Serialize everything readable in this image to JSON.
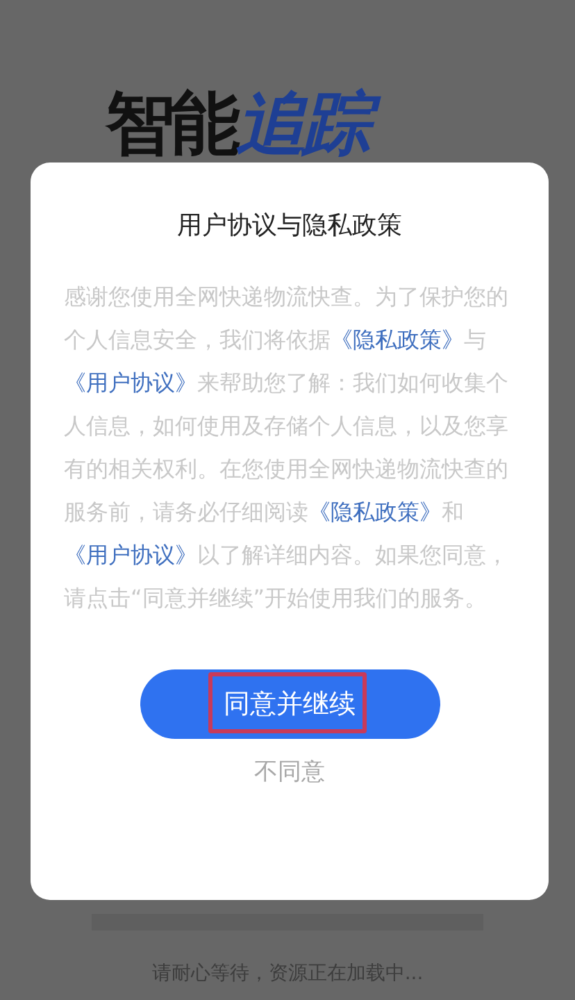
{
  "logo": [
    {
      "text": "智能",
      "color": "#111111"
    },
    {
      "text": "追踪",
      "color": "#1e3f94"
    }
  ],
  "dialog": {
    "title": "用户协议与隐私政策",
    "body": [
      {
        "kind": "text",
        "text": "感谢您使用全网快递物流快查。为了保护您的个人信息安全，我们将依据"
      },
      {
        "kind": "link",
        "text": "《隐私政策》"
      },
      {
        "kind": "text",
        "text": "与"
      },
      {
        "kind": "link",
        "text": "《用户协议》"
      },
      {
        "kind": "text",
        "text": "来帮助您了解：我们如何收集个人信息，如何使用及存储个人信息，以及您享有的相关权利。在您使用全网快递物流快查的服务前，请务必仔细阅读"
      },
      {
        "kind": "link",
        "text": "《隐私政策》"
      },
      {
        "kind": "text",
        "text": "和"
      },
      {
        "kind": "link",
        "text": "《用户协议》"
      },
      {
        "kind": "text",
        "text": "以了解详细内容。如果您同意，请点击“同意并继续”开始使用我们的服务。"
      }
    ],
    "agree_button": {
      "label": "同意并继续",
      "highlighted": true
    },
    "decline_button": "不同意"
  },
  "loading": {
    "message": "请耐心等待，资源正在加载中..."
  }
}
